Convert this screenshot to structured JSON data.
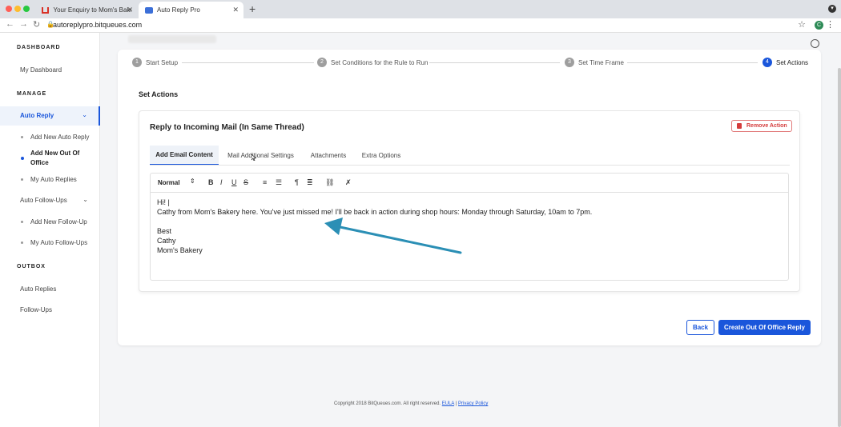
{
  "browser": {
    "tabs": [
      {
        "label": "Your Enquiry to Mom's Bakery",
        "active": false
      },
      {
        "label": "Auto Reply Pro",
        "active": true
      }
    ],
    "url": "autoreplypro.bitqueues.com",
    "profile_initial": "C"
  },
  "sidebar": {
    "dashboard_heading": "DASHBOARD",
    "my_dashboard": "My Dashboard",
    "manage_heading": "MANAGE",
    "auto_reply": "Auto Reply",
    "auto_reply_items": [
      "Add New Auto Reply",
      "Add New Out Of Office",
      "My Auto Replies"
    ],
    "auto_followups": "Auto Follow-Ups",
    "followup_items": [
      "Add New Follow-Up",
      "My Auto Follow-Ups"
    ],
    "outbox_heading": "OUTBOX",
    "outbox_items": [
      "Auto Replies",
      "Follow-Ups"
    ]
  },
  "stepper": {
    "steps": [
      {
        "num": "1",
        "label": "Start Setup"
      },
      {
        "num": "2",
        "label": "Set Conditions for the Rule to Run"
      },
      {
        "num": "3",
        "label": "Set Time Frame"
      },
      {
        "num": "4",
        "label": "Set Actions"
      }
    ],
    "active_step": 4
  },
  "main": {
    "section_title": "Set Actions",
    "action_title": "Reply to Incoming Mail (In Same Thread)",
    "remove_action": "Remove Action",
    "tabs": [
      "Add Email Content",
      "Mail Additional Settings",
      "Attachments",
      "Extra Options"
    ],
    "toolbar_format": "Normal",
    "editor_lines": [
      "Hi! |",
      "Cathy from Mom's Bakery here. You've just missed me! I'll be back in action during shop hours: Monday through Saturday, 10am to 7pm.",
      "",
      "Best",
      "Cathy",
      "Mom's Bakery"
    ],
    "back_label": "Back",
    "create_label": "Create Out Of Office Reply"
  },
  "footer": {
    "copyright": "Copyright 2018 BitQueues.com. All right reserved.",
    "eula": "EULA",
    "separator": "|",
    "privacy": "Privacy Policy"
  },
  "colors": {
    "accent": "#1a56db",
    "danger": "#d43c3c",
    "annotation_arrow": "#2b8fb5"
  }
}
